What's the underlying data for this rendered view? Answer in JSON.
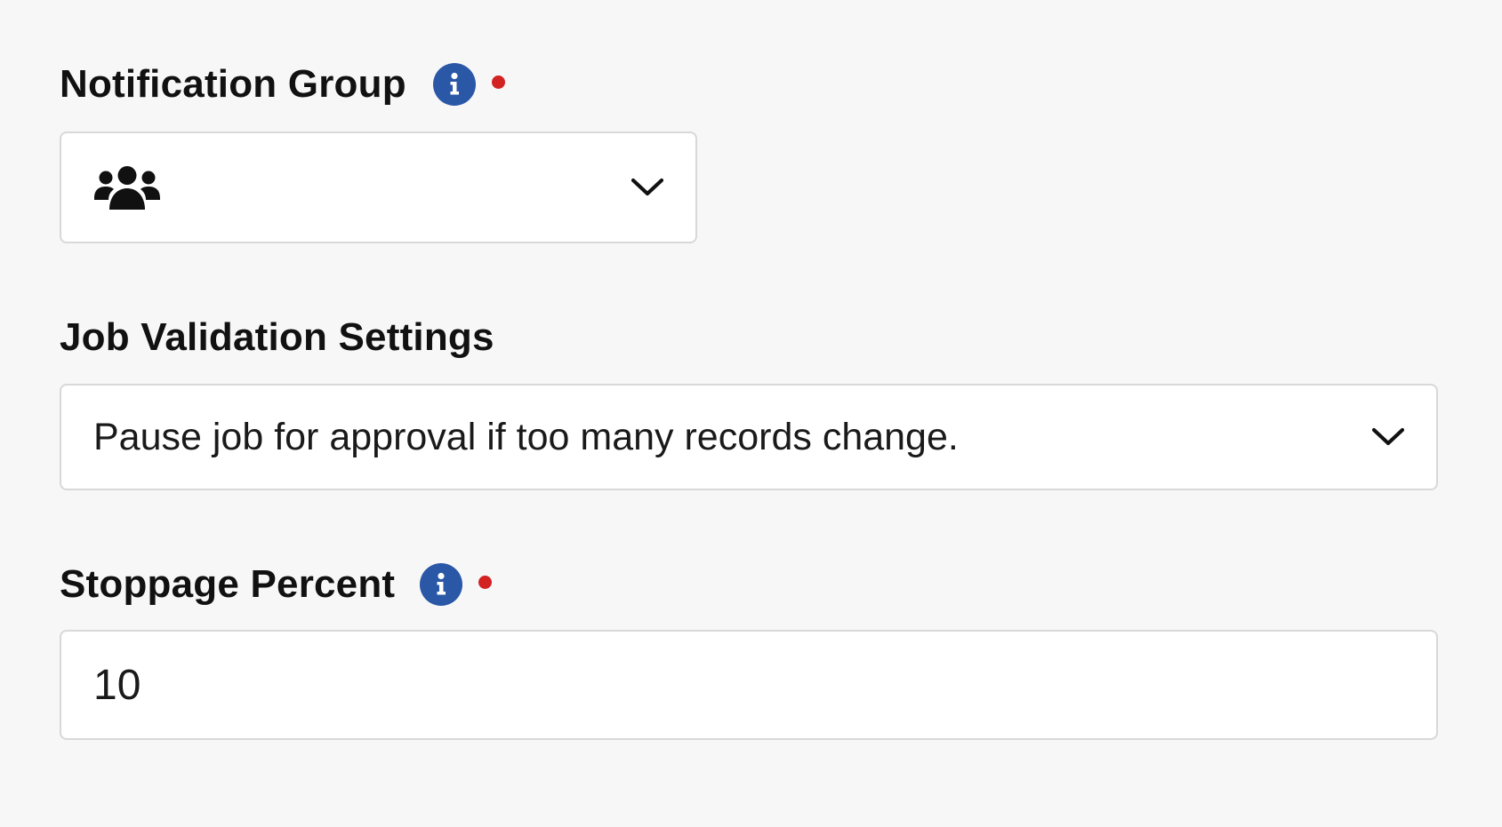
{
  "colors": {
    "background": "#f7f7f7",
    "info_badge": "#2a57a6",
    "required_dot": "#d32222",
    "field_border": "#d8d8d8"
  },
  "notification_group": {
    "label": "Notification Group",
    "info_icon": "info-icon",
    "required": true,
    "selected_icon": "users-group-icon",
    "dropdown_icon": "chevron-down-icon"
  },
  "job_validation": {
    "label": "Job Validation Settings",
    "selected_value": "Pause job for approval if too many records change.",
    "dropdown_icon": "chevron-down-icon"
  },
  "stoppage_percent": {
    "label": "Stoppage Percent",
    "info_icon": "info-icon",
    "required": true,
    "value": "10"
  }
}
